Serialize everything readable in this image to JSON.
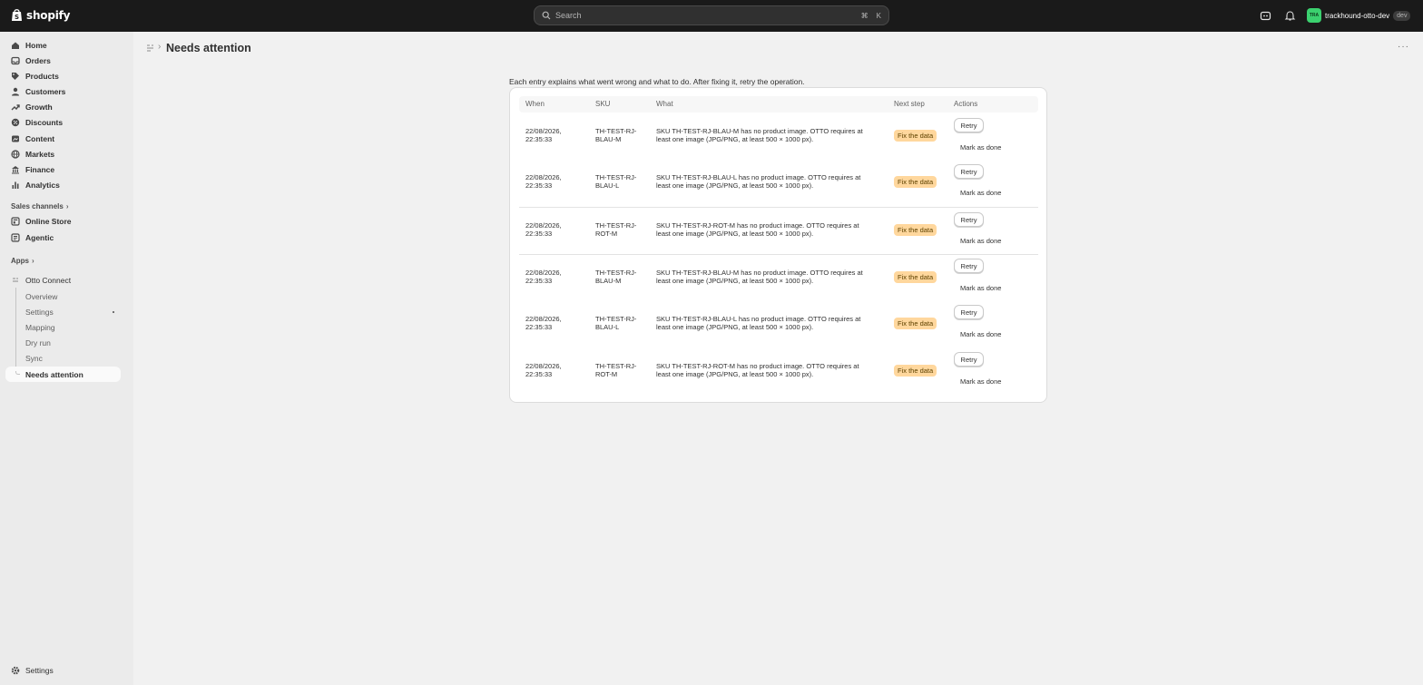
{
  "topbar": {
    "brand": "shopify",
    "search_placeholder": "Search",
    "shortcut_cmd": "⌘",
    "shortcut_key": "K",
    "avatar_initials": "TRA",
    "store_name": "trackhound-otto-dev",
    "store_badge": "dev"
  },
  "sidebar": {
    "items": [
      {
        "label": "Home",
        "icon": "home-icon"
      },
      {
        "label": "Orders",
        "icon": "inbox-icon"
      },
      {
        "label": "Products",
        "icon": "tag-icon"
      },
      {
        "label": "Customers",
        "icon": "person-icon"
      },
      {
        "label": "Growth",
        "icon": "growth-icon"
      },
      {
        "label": "Discounts",
        "icon": "discount-icon"
      },
      {
        "label": "Content",
        "icon": "content-icon"
      },
      {
        "label": "Markets",
        "icon": "globe-icon"
      },
      {
        "label": "Finance",
        "icon": "bank-icon"
      },
      {
        "label": "Analytics",
        "icon": "chart-icon"
      }
    ],
    "sales_channels": "Sales channels",
    "channels": [
      {
        "label": "Online Store",
        "icon": "store-icon"
      },
      {
        "label": "Agentic",
        "icon": "agentic-icon"
      }
    ],
    "apps": "Apps",
    "app_name": "Otto Connect",
    "app_subitems": [
      "Overview",
      "Settings",
      "Mapping",
      "Dry run",
      "Sync",
      "Needs attention"
    ],
    "settings": "Settings"
  },
  "page": {
    "title": "Needs attention",
    "intro": "Each entry explains what went wrong and what to do. After fixing it, retry the operation."
  },
  "table": {
    "headers": [
      "When",
      "SKU",
      "What",
      "Next step",
      "Actions"
    ],
    "retry_label": "Retry",
    "done_label": "Mark as done",
    "rows": [
      {
        "when1": "22/08/2026,",
        "when2": "22:35:33",
        "sku1": "TH-TEST-RJ-",
        "sku2": "BLAU-M",
        "what1": "SKU TH-TEST-RJ-BLAU-M has no product image. OTTO requires at",
        "what2": "least one image (JPG/PNG, at least 500 × 1000 px).",
        "step": "Fix the data"
      },
      {
        "when1": "22/08/2026,",
        "when2": "22:35:33",
        "sku1": "TH-TEST-RJ-",
        "sku2": "BLAU-L",
        "what1": "SKU TH-TEST-RJ-BLAU-L has no product image. OTTO requires at",
        "what2": "least one image (JPG/PNG, at least 500 × 1000 px).",
        "step": "Fix the data"
      },
      {
        "when1": "22/08/2026,",
        "when2": "22:35:33",
        "sku1": "TH-TEST-RJ-",
        "sku2": "ROT-M",
        "what1": "SKU TH-TEST-RJ-ROT-M has no product image. OTTO requires at",
        "what2": "least one image (JPG/PNG, at least 500 × 1000 px).",
        "step": "Fix the data"
      },
      {
        "when1": "22/08/2026,",
        "when2": "22:35:33",
        "sku1": "TH-TEST-RJ-",
        "sku2": "BLAU-M",
        "what1": "SKU TH-TEST-RJ-BLAU-M has no product image. OTTO requires at",
        "what2": "least one image (JPG/PNG, at least 500 × 1000 px).",
        "step": "Fix the data"
      },
      {
        "when1": "22/08/2026,",
        "when2": "22:35:33",
        "sku1": "TH-TEST-RJ-",
        "sku2": "BLAU-L",
        "what1": "SKU TH-TEST-RJ-BLAU-L has no product image. OTTO requires at",
        "what2": "least one image (JPG/PNG, at least 500 × 1000 px).",
        "step": "Fix the data"
      },
      {
        "when1": "22/08/2026,",
        "when2": "22:35:33",
        "sku1": "TH-TEST-RJ-",
        "sku2": "ROT-M",
        "what1": "SKU TH-TEST-RJ-ROT-M has no product image. OTTO requires at",
        "what2": "least one image (JPG/PNG, at least 500 × 1000 px).",
        "step": "Fix the data"
      }
    ]
  },
  "colors": {
    "topbar": "#1a1a1a",
    "badge_bg": "#ffd79d",
    "avatar": "#3bd16f"
  }
}
